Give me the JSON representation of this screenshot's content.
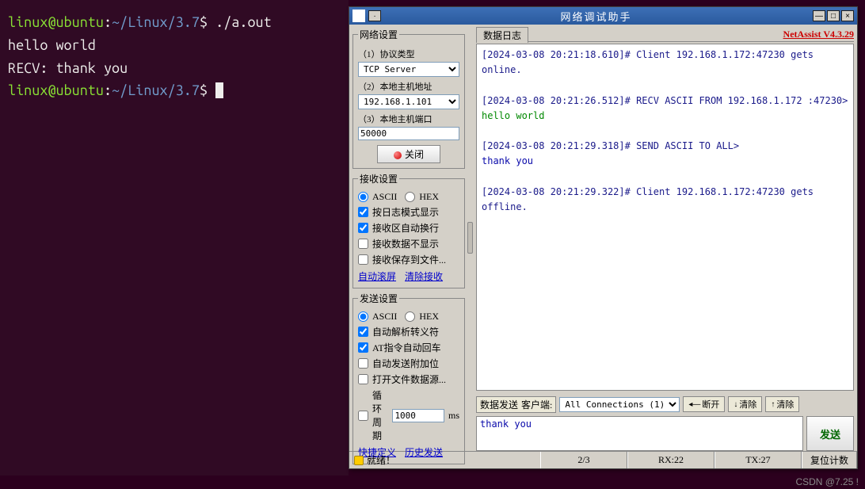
{
  "terminal": {
    "prompt_user": "linux@ubuntu",
    "prompt_path": "~/Linux/3.7",
    "prompt_symbol": "$",
    "lines": {
      "cmd1": "./a.out",
      "out1": "hello world",
      "out2": "RECV: thank you"
    }
  },
  "netassist": {
    "title": "网络调试助手",
    "version": "NetAssist V4.3.29",
    "network_settings": {
      "legend": "网络设置",
      "protocol_label": "（1）协议类型",
      "protocol_value": "TCP Server",
      "host_label": "（2）本地主机地址",
      "host_value": "192.168.1.101",
      "port_label": "（3）本地主机端口",
      "port_value": "50000",
      "close_btn": "关闭"
    },
    "recv_settings": {
      "legend": "接收设置",
      "ascii": "ASCII",
      "hex": "HEX",
      "opt_logmode": "按日志模式显示",
      "opt_autowrap": "接收区自动换行",
      "opt_hide": "接收数据不显示",
      "opt_save": "接收保存到文件...",
      "link_autoscroll": "自动滚屏",
      "link_clear": "清除接收"
    },
    "send_settings": {
      "legend": "发送设置",
      "ascii": "ASCII",
      "hex": "HEX",
      "opt_autoparse": "自动解析转义符",
      "opt_atreturn": "AT指令自动回车",
      "opt_autoappend": "自动发送附加位",
      "opt_openfile": "打开文件数据源...",
      "opt_cycle_prefix": "循环周期",
      "cycle_value": "1000",
      "cycle_unit": "ms",
      "link_quickdef": "快捷定义",
      "link_history": "历史发送"
    },
    "log": {
      "tab": "数据日志",
      "lines": {
        "l1": "[2024-03-08 20:21:18.610]# Client 192.168.1.172:47230 gets online.",
        "l2": "[2024-03-08 20:21:26.512]# RECV ASCII FROM 192.168.1.172 :47230>",
        "l3": "hello world",
        "l4": "[2024-03-08 20:21:29.318]# SEND ASCII TO ALL>",
        "l5": "thank you",
        "l6": "[2024-03-08 20:21:29.322]# Client 192.168.1.172:47230 gets offline."
      }
    },
    "sendbar": {
      "send_label": "数据发送",
      "client_label": "客户端:",
      "connection_select": "All Connections (1)",
      "disconnect": "断开",
      "clear1": "清除",
      "clear2": "清除"
    },
    "send_input": "thank you",
    "send_button": "发送",
    "status": {
      "ready": "就绪！",
      "count": "2/3",
      "rx": "RX:22",
      "tx": "TX:27",
      "reset": "复位计数"
    }
  },
  "watermark": "CSDN @7.25 !"
}
